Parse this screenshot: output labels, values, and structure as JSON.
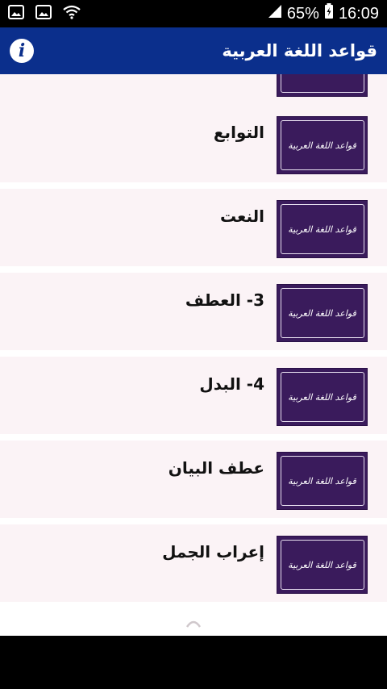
{
  "status": {
    "battery": "65%",
    "time": "16:09"
  },
  "app_bar": {
    "title": "قواعد اللغة العربية"
  },
  "thumbnail_text": "قواعد اللغة العربية",
  "items": [
    {
      "label": ""
    },
    {
      "label": "التوابع"
    },
    {
      "label": "النعت"
    },
    {
      "label": "3- العطف"
    },
    {
      "label": "4- البدل"
    },
    {
      "label": "عطف البيان"
    },
    {
      "label": "إعراب الجمل"
    }
  ],
  "colors": {
    "app_bar": "#0b2f8c",
    "thumb": "#3a1b5c",
    "item_bg": "#fbf3f6"
  }
}
